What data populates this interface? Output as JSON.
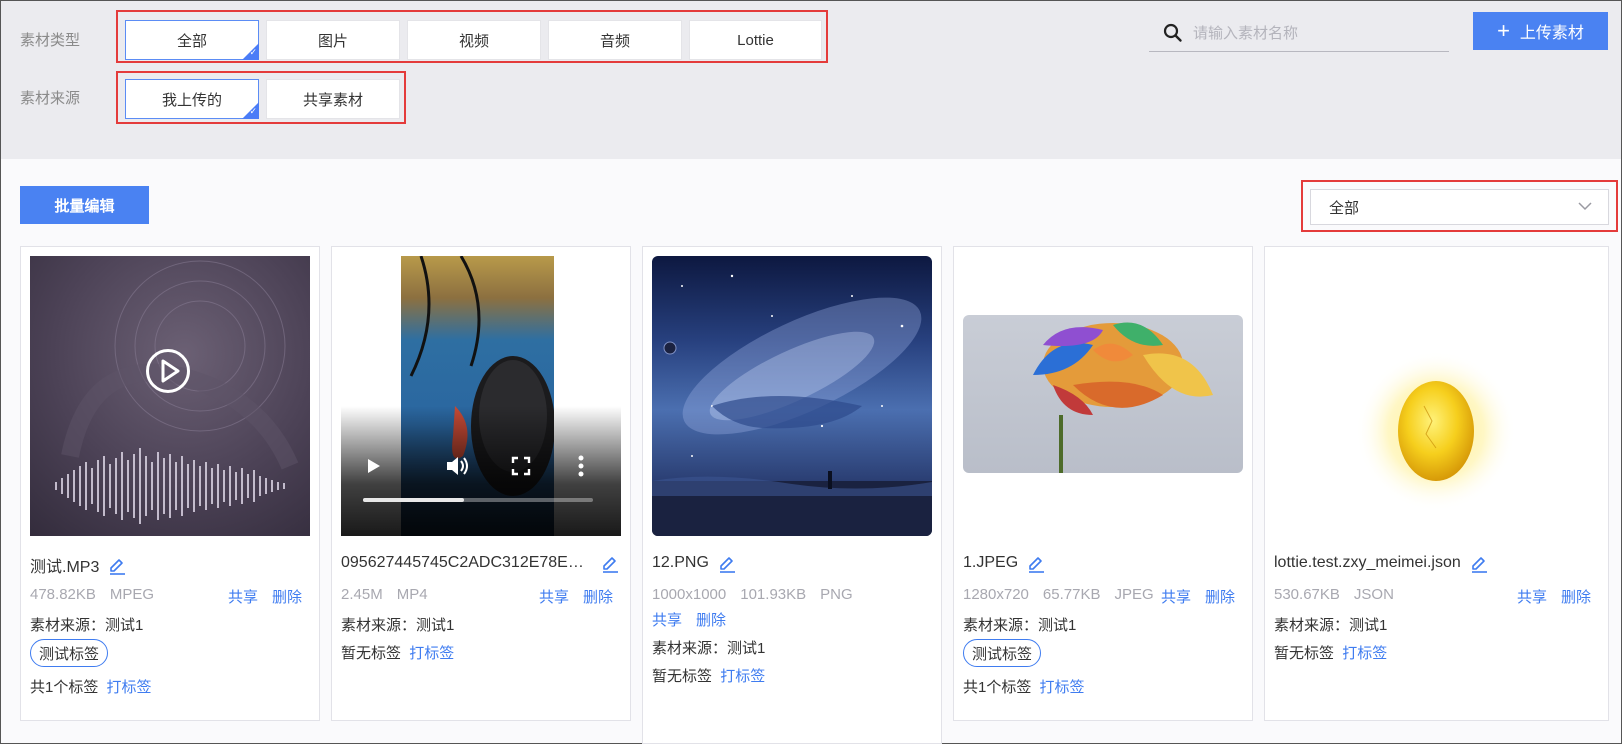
{
  "filters": {
    "type_label": "素材类型",
    "type_options": [
      "全部",
      "图片",
      "视频",
      "音频",
      "Lottie"
    ],
    "source_label": "素材来源",
    "source_options": [
      "我上传的",
      "共享素材"
    ]
  },
  "search": {
    "placeholder": "请输入素材名称",
    "value": ""
  },
  "upload_button": {
    "icon": "plus-icon",
    "label": "上传素材"
  },
  "toolbar": {
    "batch_edit_label": "批量编辑",
    "sort_selected": "全部"
  },
  "accent_color": "#4a82f2",
  "highlight_color": "#e43b3b",
  "labels": {
    "share": "共享",
    "delete": "删除",
    "source_prefix": "素材来源：",
    "no_tag": "暂无标签",
    "tag_action": "打标签"
  },
  "cards": [
    {
      "kind": "audio",
      "name": "测试.MP3",
      "size": "478.82KB",
      "format": "MPEG",
      "source": "测试1",
      "tag": "测试标签",
      "tag_count": "共1个标签"
    },
    {
      "kind": "video",
      "name": "095627445745C2ADC312E78E…",
      "size": "2.45M",
      "format": "MP4",
      "source": "测试1"
    },
    {
      "kind": "image",
      "name": "12.PNG",
      "dims": "1000x1000",
      "size": "101.93KB",
      "format": "PNG",
      "source": "测试1"
    },
    {
      "kind": "image",
      "name": "1.JPEG",
      "dims": "1280x720",
      "size": "65.77KB",
      "format": "JPEG",
      "source": "测试1",
      "tag": "测试标签",
      "tag_count": "共1个标签"
    },
    {
      "kind": "lottie",
      "name": "lottie.test.zxy_meimei.json",
      "size": "530.67KB",
      "format": "JSON",
      "source": "测试1"
    }
  ]
}
